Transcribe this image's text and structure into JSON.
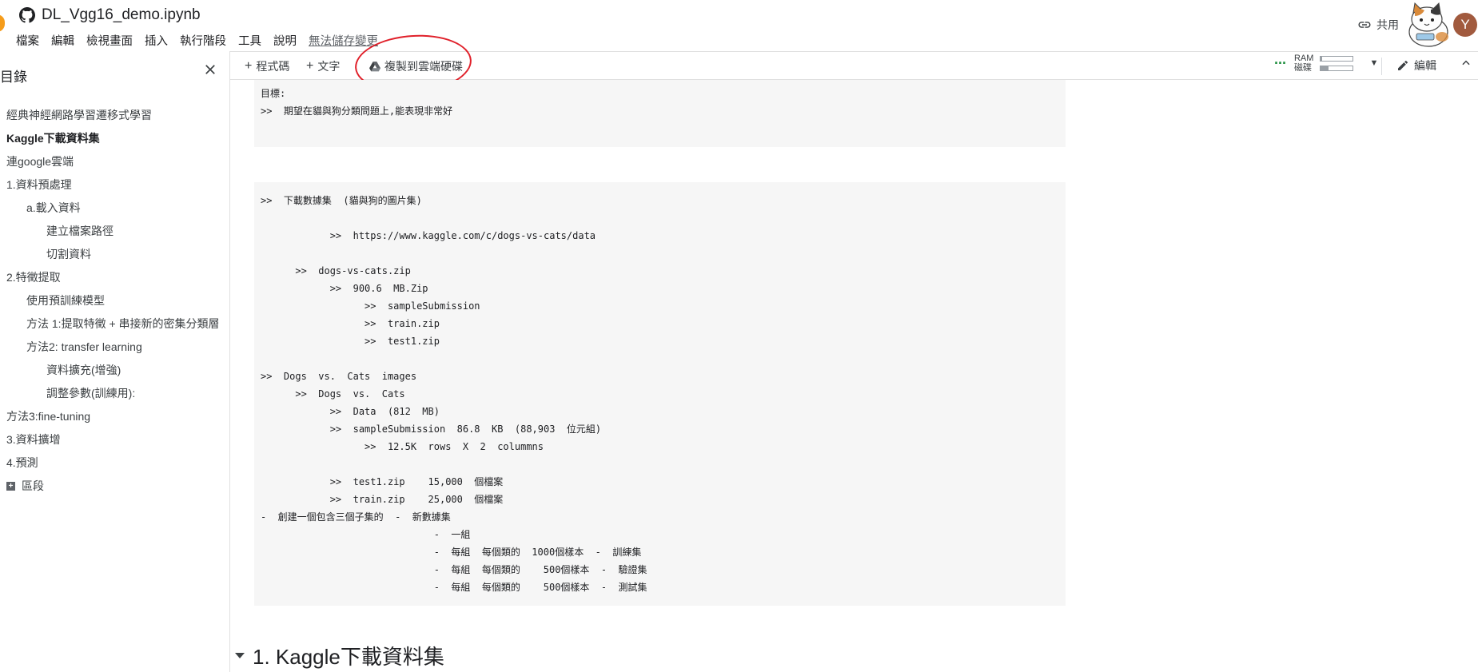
{
  "header": {
    "title": "DL_Vgg16_demo.ipynb",
    "menu": [
      "檔案",
      "編輯",
      "檢視畫面",
      "插入",
      "執行階段",
      "工具",
      "說明"
    ],
    "unsaved": "無法儲存變更",
    "share_label": "共用",
    "avatar_initial": "Y"
  },
  "toolbar": {
    "add_code": "程式碼",
    "add_text": "文字",
    "copy_drive": "複製到雲端硬碟",
    "ram_label": "RAM",
    "disk_label": "磁碟",
    "ram_level": 0.05,
    "disk_level": 0.25,
    "edit_label": "編輯"
  },
  "sidebar": {
    "title": "目錄",
    "items": [
      {
        "label": "經典神經網路學習遷移式學習",
        "level": 0
      },
      {
        "label": "Kaggle下載資料集",
        "level": 0,
        "active": true
      },
      {
        "label": "連google雲端",
        "level": 0
      },
      {
        "label": "1.資料預處理",
        "level": 0
      },
      {
        "label": "a.載入資料",
        "level": 1
      },
      {
        "label": "建立檔案路徑",
        "level": 2
      },
      {
        "label": "切割資料",
        "level": 2
      },
      {
        "label": "2.特徵提取",
        "level": 0
      },
      {
        "label": "使用預訓練模型",
        "level": 1
      },
      {
        "label": "方法 1:提取特徵 + 串接新的密集分類層",
        "level": 1
      },
      {
        "label": "方法2: transfer learning",
        "level": 1
      },
      {
        "label": "資料擴充(增強)",
        "level": 2
      },
      {
        "label": "調整參數(訓練用):",
        "level": 2
      },
      {
        "label": "方法3:fine-tuning",
        "level": 0
      },
      {
        "label": "3.資料擴增",
        "level": 0
      },
      {
        "label": "4.預測",
        "level": 0
      }
    ],
    "add_section": "區段"
  },
  "cells": {
    "cell1": [
      "目標:",
      ">>  期望在貓與狗分類問題上,能表現非常好"
    ],
    "cell2": [
      ">>  下載數據集  (貓與狗的圖片集)",
      "",
      "            >>  https://www.kaggle.com/c/dogs-vs-cats/data",
      "",
      "      >>  dogs-vs-cats.zip",
      "            >>  900.6  MB.Zip",
      "                  >>  sampleSubmission",
      "                  >>  train.zip",
      "                  >>  test1.zip",
      "",
      ">>  Dogs  vs.  Cats  images",
      "      >>  Dogs  vs.  Cats",
      "            >>  Data  (812  MB)",
      "            >>  sampleSubmission  86.8  KB  (88,903  位元組)",
      "                  >>  12.5K  rows  X  2  colummns",
      "",
      "            >>  test1.zip    15,000  個檔案",
      "            >>  train.zip    25,000  個檔案",
      "-  創建一個包含三個子集的  -  新數據集",
      "                              -  一組",
      "                              -  每組  每個類的  1000個樣本  -  訓練集",
      "                              -  每組  每個類的    500個樣本  -  驗證集",
      "                              -  每組  每個類的    500個樣本  -  測試集"
    ]
  },
  "section_heading": "1. Kaggle下載資料集"
}
